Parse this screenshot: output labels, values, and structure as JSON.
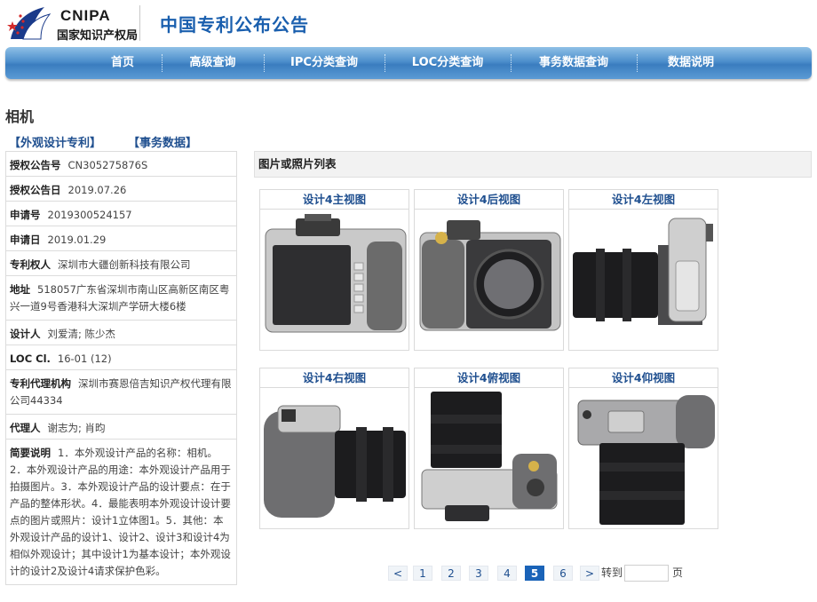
{
  "header": {
    "logo_en": "CNIPA",
    "logo_cn": "国家知识产权局",
    "site_title": "中国专利公布公告"
  },
  "nav": [
    "首页",
    "高级查询",
    "IPC分类查询",
    "LOC分类查询",
    "事务数据查询",
    "数据说明"
  ],
  "page_title": "相机",
  "tabs": [
    "【外观设计专利】",
    "【事务数据】"
  ],
  "info": [
    {
      "label": "授权公告号",
      "value": "CN305275876S"
    },
    {
      "label": "授权公告日",
      "value": "2019.07.26"
    },
    {
      "label": "申请号",
      "value": "2019300524157"
    },
    {
      "label": "申请日",
      "value": "2019.01.29"
    },
    {
      "label": "专利权人",
      "value": "深圳市大疆创新科技有限公司"
    },
    {
      "label": "地址",
      "value": "518057广东省深圳市南山区高新区南区粤兴一道9号香港科大深圳产学研大楼6楼"
    },
    {
      "label": "设计人",
      "value": "刘爱清; 陈少杰"
    },
    {
      "label": "LOC Cl.",
      "value": "16-01 (12)"
    },
    {
      "label": "专利代理机构",
      "value": "深圳市赛恩倍吉知识产权代理有限公司44334"
    },
    {
      "label": "代理人",
      "value": "谢志为; 肖昀"
    },
    {
      "label": "简要说明",
      "value": "1．本外观设计产品的名称：相机。2．本外观设计产品的用途：本外观设计产品用于拍摄图片。3．本外观设计产品的设计要点：在于产品的整体形状。4．最能表明本外观设计设计要点的图片或照片：设计1立体图1。5．其他：本外观设计产品的设计1、设计2、设计3和设计4为相似外观设计；其中设计1为基本设计；本外观设计的设计2及设计4请求保护色彩。"
    }
  ],
  "images_panel_title": "图片或照片列表",
  "images": [
    {
      "caption": "设计4主视图",
      "icon": "camera-front-view"
    },
    {
      "caption": "设计4后视图",
      "icon": "camera-back-view"
    },
    {
      "caption": "设计4左视图",
      "icon": "camera-left-view"
    },
    {
      "caption": "设计4右视图",
      "icon": "camera-right-view"
    },
    {
      "caption": "设计4俯视图",
      "icon": "camera-top-view"
    },
    {
      "caption": "设计4仰视图",
      "icon": "camera-bottom-view"
    }
  ],
  "pager": {
    "prev": "<",
    "pages": [
      "1",
      "2",
      "3",
      "4",
      "5",
      "6"
    ],
    "current": "5",
    "next": ">",
    "goto_label": "转到",
    "goto_value": "",
    "page_suffix": "页"
  },
  "colors": {
    "link": "#1f4f8f",
    "title": "#1a5fae",
    "nav": "#3a7dbf",
    "active_page": "#1a63b8"
  }
}
